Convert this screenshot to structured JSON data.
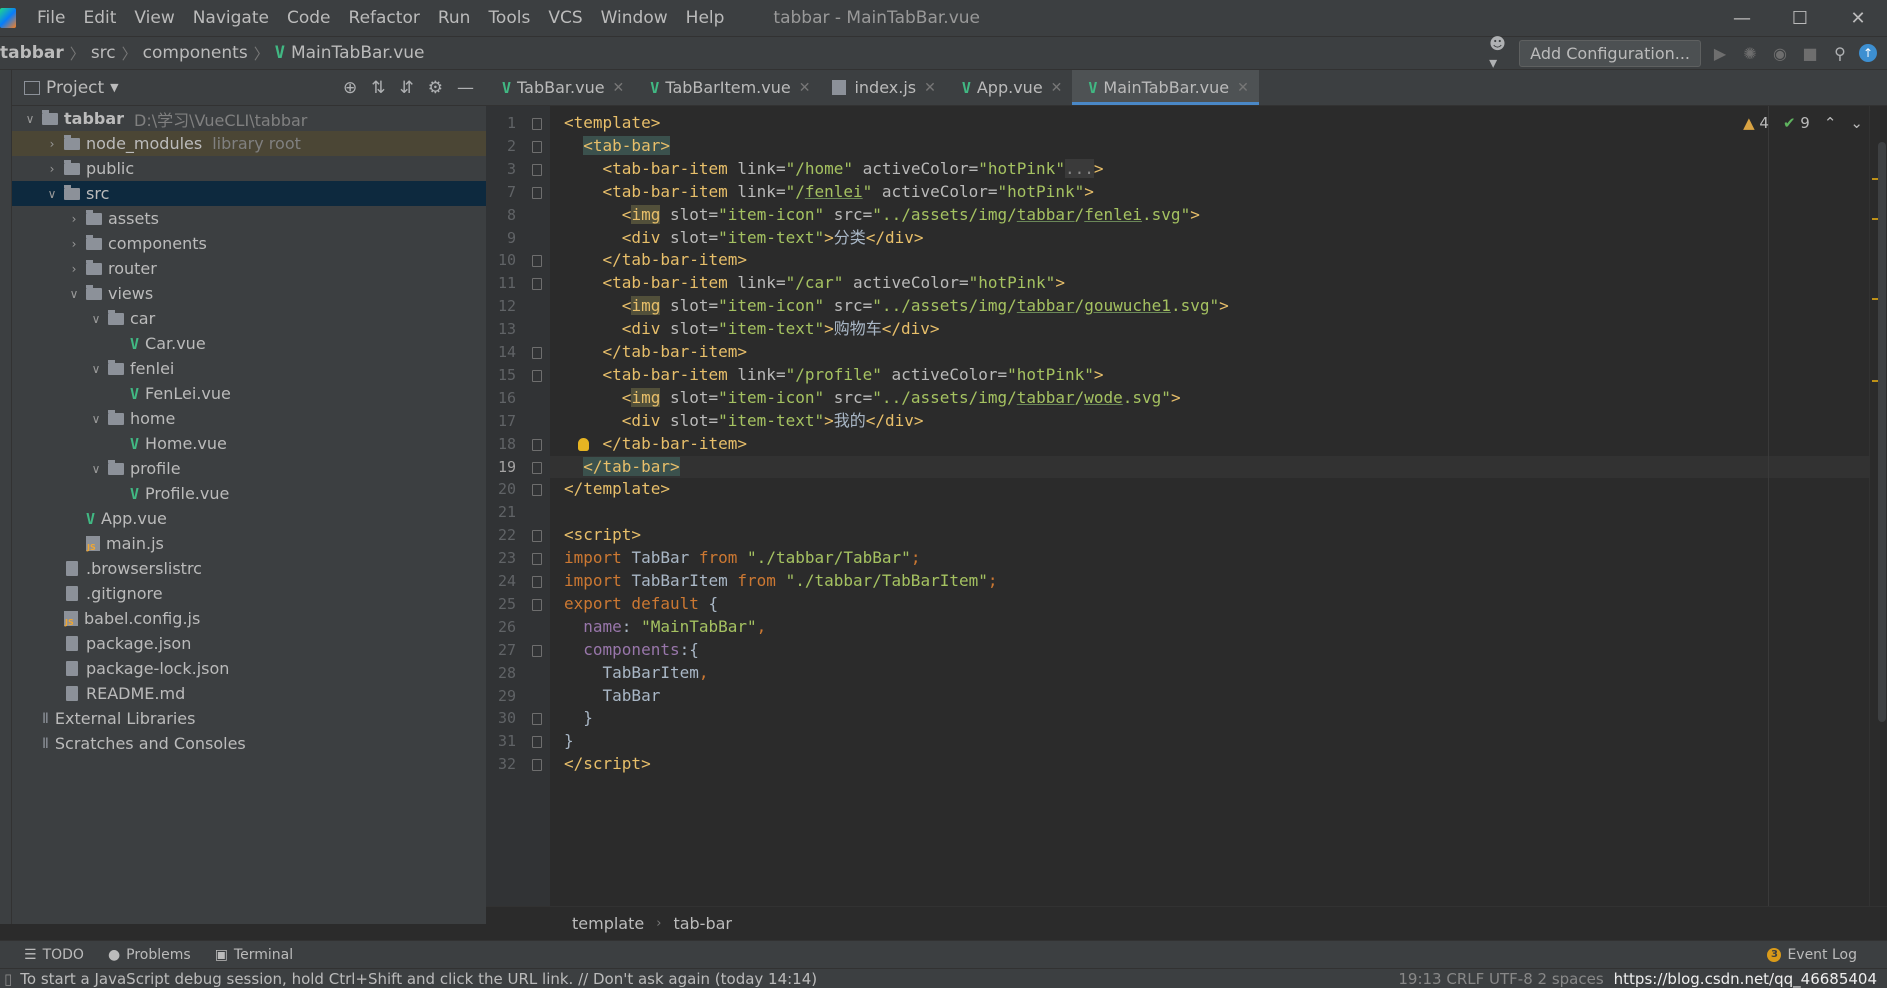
{
  "titlebar": {
    "menu": [
      "File",
      "Edit",
      "View",
      "Navigate",
      "Code",
      "Refactor",
      "Run",
      "Tools",
      "VCS",
      "Window",
      "Help"
    ],
    "window_title": "tabbar - MainTabBar.vue",
    "controls": [
      "—",
      "☐",
      "✕"
    ]
  },
  "navbar": {
    "crumbs": [
      "tabbar",
      "src",
      "components",
      "MainTabBar.vue"
    ],
    "add_configuration": "Add Configuration..."
  },
  "project_panel": {
    "title": "Project",
    "tree": [
      {
        "label": "tabbar",
        "extra": "D:\\学习\\VueCLI\\tabbar",
        "type": "folder",
        "depth": 0,
        "open": true
      },
      {
        "label": "node_modules",
        "extra": "library root",
        "type": "folder",
        "depth": 1,
        "open": false,
        "highlight": true
      },
      {
        "label": "public",
        "extra": "",
        "type": "folder",
        "depth": 1,
        "open": false
      },
      {
        "label": "src",
        "extra": "",
        "type": "folder",
        "depth": 1,
        "open": true,
        "selected": true
      },
      {
        "label": "assets",
        "extra": "",
        "type": "folder",
        "depth": 2,
        "open": false
      },
      {
        "label": "components",
        "extra": "",
        "type": "folder",
        "depth": 2,
        "open": false
      },
      {
        "label": "router",
        "extra": "",
        "type": "folder",
        "depth": 2,
        "open": false
      },
      {
        "label": "views",
        "extra": "",
        "type": "folder",
        "depth": 2,
        "open": true
      },
      {
        "label": "car",
        "extra": "",
        "type": "folder",
        "depth": 3,
        "open": true
      },
      {
        "label": "Car.vue",
        "extra": "",
        "type": "vue",
        "depth": 4
      },
      {
        "label": "fenlei",
        "extra": "",
        "type": "folder",
        "depth": 3,
        "open": true
      },
      {
        "label": "FenLei.vue",
        "extra": "",
        "type": "vue",
        "depth": 4
      },
      {
        "label": "home",
        "extra": "",
        "type": "folder",
        "depth": 3,
        "open": true
      },
      {
        "label": "Home.vue",
        "extra": "",
        "type": "vue",
        "depth": 4
      },
      {
        "label": "profile",
        "extra": "",
        "type": "folder",
        "depth": 3,
        "open": true
      },
      {
        "label": "Profile.vue",
        "extra": "",
        "type": "vue",
        "depth": 4
      },
      {
        "label": "App.vue",
        "extra": "",
        "type": "vue",
        "depth": 2
      },
      {
        "label": "main.js",
        "extra": "",
        "type": "js",
        "depth": 2
      },
      {
        "label": ".browserslistrc",
        "extra": "",
        "type": "file",
        "depth": 1
      },
      {
        "label": ".gitignore",
        "extra": "",
        "type": "file",
        "depth": 1
      },
      {
        "label": "babel.config.js",
        "extra": "",
        "type": "js",
        "depth": 1
      },
      {
        "label": "package.json",
        "extra": "",
        "type": "file",
        "depth": 1
      },
      {
        "label": "package-lock.json",
        "extra": "",
        "type": "file",
        "depth": 1
      },
      {
        "label": "README.md",
        "extra": "",
        "type": "file",
        "depth": 1
      },
      {
        "label": "External Libraries",
        "extra": "",
        "type": "lib",
        "depth": 0
      },
      {
        "label": "Scratches and Consoles",
        "extra": "",
        "type": "lib",
        "depth": 0
      }
    ]
  },
  "tabs": [
    {
      "label": "TabBar.vue",
      "icon": "vue",
      "active": false
    },
    {
      "label": "TabBarItem.vue",
      "icon": "vue",
      "active": false
    },
    {
      "label": "index.js",
      "icon": "js",
      "active": false
    },
    {
      "label": "App.vue",
      "icon": "vue",
      "active": false
    },
    {
      "label": "MainTabBar.vue",
      "icon": "vue",
      "active": true
    }
  ],
  "inspections": {
    "warnings": "4",
    "ok": "9"
  },
  "editor": {
    "current_line": "19",
    "lines": [
      {
        "n": "1",
        "html": "<span class=\"tag\">&lt;template&gt;</span>"
      },
      {
        "n": "2",
        "html": "  <span class=\"tag tagbox\">&lt;tab-bar&gt;</span>"
      },
      {
        "n": "3",
        "html": "    <span class=\"tag\">&lt;tab-bar-item</span> <span class=\"attr\">link=</span><span class=\"str\">\"/home\"</span> <span class=\"attr\">activeColor=</span><span class=\"str\">\"hotPink\"</span><span class=\"dots\">...</span><span class=\"tag\">&gt;</span>"
      },
      {
        "n": "7",
        "html": "    <span class=\"tag\">&lt;tab-bar-item</span> <span class=\"attr\">link=</span><span class=\"str\">\"/<span class=\"ul\">fenlei</span>\"</span> <span class=\"attr\">activeColor=</span><span class=\"str\">\"hotPink\"</span><span class=\"tag\">&gt;</span>"
      },
      {
        "n": "8",
        "html": "      <span class=\"tag\">&lt;<span class=\"imghl\">img</span></span> <span class=\"attr\">slot=</span><span class=\"str\">\"item-icon\"</span> <span class=\"attr\">src=</span><span class=\"str\">\"../assets/img/<span class=\"ul\">tabbar</span>/<span class=\"ul\">fenlei</span>.svg\"</span><span class=\"tag\">&gt;</span>"
      },
      {
        "n": "9",
        "html": "      <span class=\"tag\">&lt;div</span> <span class=\"attr\">slot=</span><span class=\"str\">\"item-text\"</span><span class=\"tag\">&gt;</span><span class=\"txt\">分类</span><span class=\"tag\">&lt;/div&gt;</span>"
      },
      {
        "n": "10",
        "html": "    <span class=\"tag\">&lt;/tab-bar-item&gt;</span>"
      },
      {
        "n": "11",
        "html": "    <span class=\"tag\">&lt;tab-bar-item</span> <span class=\"attr\">link=</span><span class=\"str\">\"/car\"</span> <span class=\"attr\">activeColor=</span><span class=\"str\">\"hotPink\"</span><span class=\"tag\">&gt;</span>"
      },
      {
        "n": "12",
        "html": "      <span class=\"tag\">&lt;<span class=\"imghl\">img</span></span> <span class=\"attr\">slot=</span><span class=\"str\">\"item-icon\"</span> <span class=\"attr\">src=</span><span class=\"str\">\"../assets/img/<span class=\"ul\">tabbar</span>/<span class=\"ul\">gouwuche1</span>.svg\"</span><span class=\"tag\">&gt;</span>"
      },
      {
        "n": "13",
        "html": "      <span class=\"tag\">&lt;div</span> <span class=\"attr\">slot=</span><span class=\"str\">\"item-text\"</span><span class=\"tag\">&gt;</span><span class=\"txt\">购物车</span><span class=\"tag\">&lt;/div&gt;</span>"
      },
      {
        "n": "14",
        "html": "    <span class=\"tag\">&lt;/tab-bar-item&gt;</span>"
      },
      {
        "n": "15",
        "html": "    <span class=\"tag\">&lt;tab-bar-item</span> <span class=\"attr\">link=</span><span class=\"str\">\"/profile\"</span> <span class=\"attr\">activeColor=</span><span class=\"str\">\"hotPink\"</span><span class=\"tag\">&gt;</span>"
      },
      {
        "n": "16",
        "html": "      <span class=\"tag\">&lt;<span class=\"imghl\">img</span></span> <span class=\"attr\">slot=</span><span class=\"str\">\"item-icon\"</span> <span class=\"attr\">src=</span><span class=\"str\">\"../assets/img/<span class=\"ul\">tabbar</span>/<span class=\"ul\">wode</span>.svg\"</span><span class=\"tag\">&gt;</span>"
      },
      {
        "n": "17",
        "html": "      <span class=\"tag\">&lt;div</span> <span class=\"attr\">slot=</span><span class=\"str\">\"item-text\"</span><span class=\"tag\">&gt;</span><span class=\"txt\">我的</span><span class=\"tag\">&lt;/div&gt;</span>"
      },
      {
        "n": "18",
        "html": "    <span class=\"tag\">&lt;/tab-bar-item&gt;</span>"
      },
      {
        "n": "19",
        "html": "  <span class=\"tag tagbox\">&lt;/tab-bar&gt;</span>"
      },
      {
        "n": "20",
        "html": "<span class=\"tag\">&lt;/template&gt;</span>"
      },
      {
        "n": "21",
        "html": ""
      },
      {
        "n": "22",
        "html": "<span class=\"tag\">&lt;script&gt;</span>"
      },
      {
        "n": "23",
        "html": "<span class=\"kw\">import</span> <span class=\"txt\">TabBar</span> <span class=\"kw\">from</span> <span class=\"str\">\"./tabbar/TabBar\"</span><span class=\"kw\">;</span>"
      },
      {
        "n": "24",
        "html": "<span class=\"kw\">import</span> <span class=\"txt\">TabBarItem</span> <span class=\"kw\">from</span> <span class=\"str\">\"./tabbar/TabBarItem\"</span><span class=\"kw\">;</span>"
      },
      {
        "n": "25",
        "html": "<span class=\"kw\">export default</span> <span class=\"txt\">{</span>"
      },
      {
        "n": "26",
        "html": "  <span class=\"prop\">name</span><span class=\"txt\">: </span><span class=\"str\">\"MainTabBar\"</span><span class=\"kw\">,</span>"
      },
      {
        "n": "27",
        "html": "  <span class=\"prop\">components</span><span class=\"txt\">:{</span>"
      },
      {
        "n": "28",
        "html": "    <span class=\"txt\">TabBarItem</span><span class=\"kw\">,</span>"
      },
      {
        "n": "29",
        "html": "    <span class=\"txt\">TabBar</span>"
      },
      {
        "n": "30",
        "html": "  <span class=\"txt\">}</span>"
      },
      {
        "n": "31",
        "html": "<span class=\"txt\">}</span>"
      },
      {
        "n": "32",
        "html": "<span class=\"tag\">&lt;/script&gt;</span>"
      }
    ],
    "folds": [
      "1",
      "2",
      "3",
      "7",
      "10",
      "11",
      "14",
      "15",
      "18",
      "19",
      "20",
      "22",
      "23",
      "24",
      "25",
      "27",
      "30",
      "31",
      "32"
    ]
  },
  "editor_breadcrumb": [
    "template",
    "tab-bar"
  ],
  "toolwindows": {
    "todo": "TODO",
    "problems": "Problems",
    "terminal": "Terminal",
    "event_log": "Event Log",
    "event_count": "3"
  },
  "status": {
    "message": "To start a JavaScript debug session, hold Ctrl+Shift and click the URL link. // Don't ask again (today 14:14)",
    "right": "19:13   CRLF   UTF-8   2 spaces",
    "watermark": "https://blog.csdn.net/qq_46685404"
  }
}
